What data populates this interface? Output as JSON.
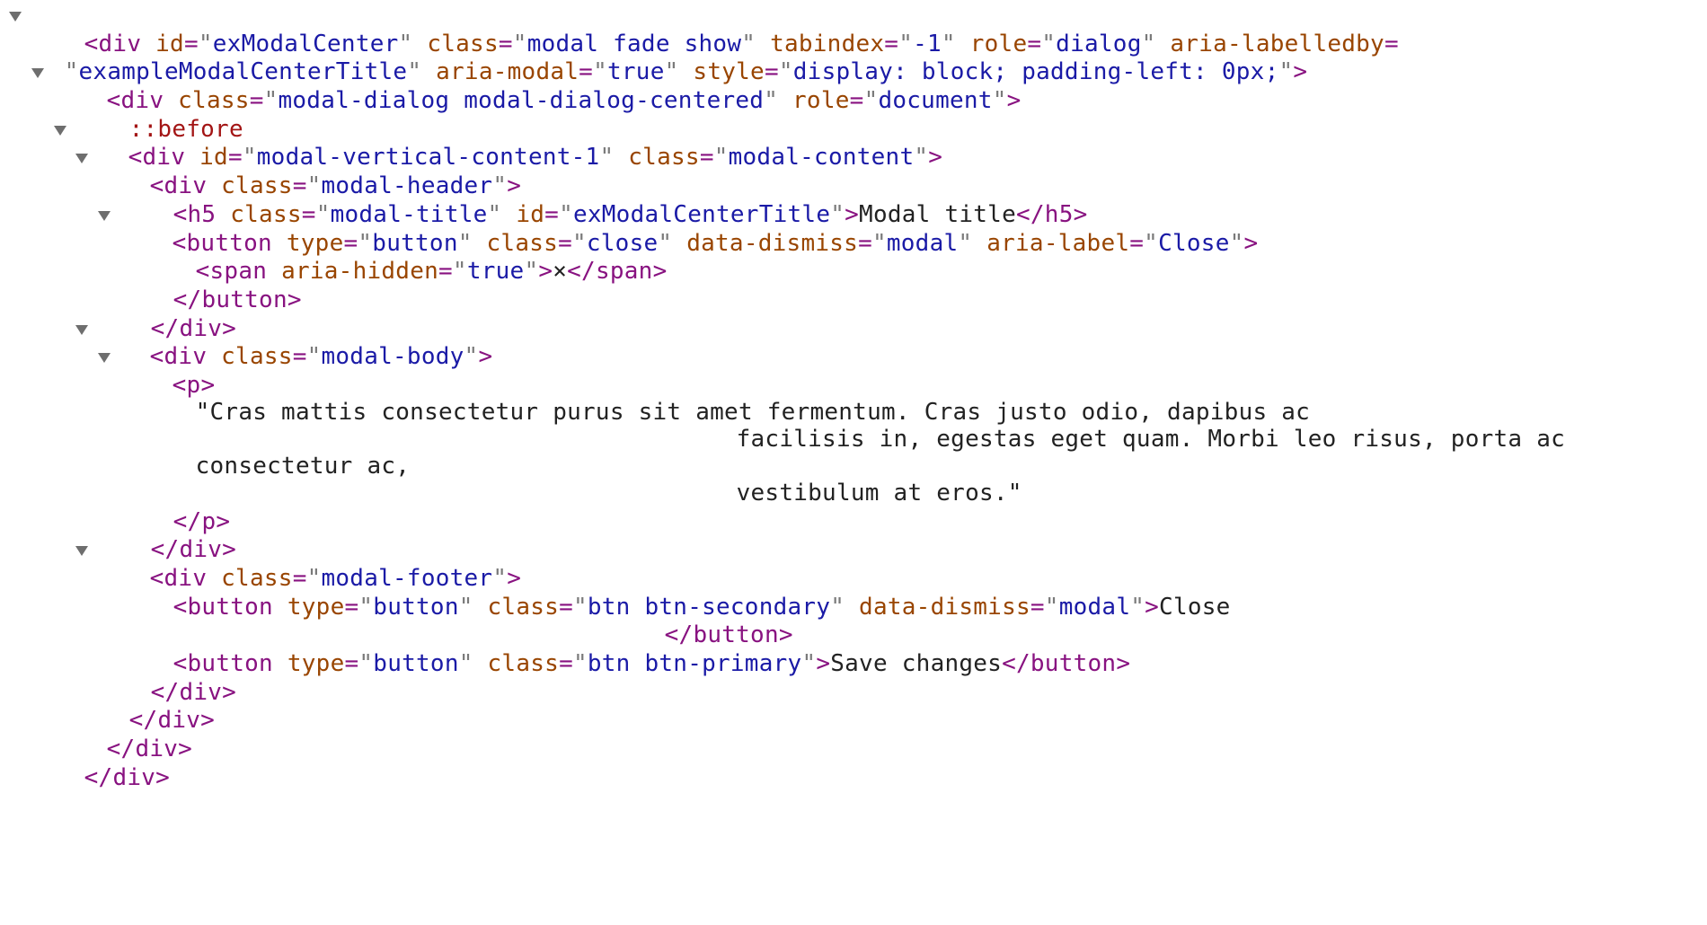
{
  "dom": {
    "l1": {
      "tag": "div",
      "a1": "id",
      "v1": "exModalCenter",
      "a2": "class",
      "v2": "modal fade show",
      "a3": "tabindex",
      "v3": "-1",
      "a4": "role",
      "v4": "dialog",
      "a5": "aria-labelledby",
      "v5": "exampleModalCenterTitle",
      "a6": "aria-modal",
      "v6": "true",
      "a7": "style",
      "v7": "display: block; padding-left: 0px;"
    },
    "l2": {
      "tag": "div",
      "a1": "class",
      "v1": "modal-dialog modal-dialog-centered",
      "a2": "role",
      "v2": "document"
    },
    "l3": {
      "pseudo": "::before"
    },
    "l4": {
      "tag": "div",
      "a1": "id",
      "v1": "modal-vertical-content-1",
      "a2": "class",
      "v2": "modal-content"
    },
    "l5": {
      "tag": "div",
      "a1": "class",
      "v1": "modal-header"
    },
    "l6": {
      "tag": "h5",
      "a1": "class",
      "v1": "modal-title",
      "a2": "id",
      "v2": "exModalCenterTitle",
      "text": "Modal title",
      "close": "h5"
    },
    "l7": {
      "tag": "button",
      "a1": "type",
      "v1": "button",
      "a2": "class",
      "v2": "close",
      "a3": "data-dismiss",
      "v3": "modal",
      "a4": "aria-label",
      "v4": "Close"
    },
    "l8": {
      "tag": "span",
      "a1": "aria-hidden",
      "v1": "true",
      "text": "×",
      "close": "span"
    },
    "l9": {
      "close": "button"
    },
    "l10": {
      "close": "div"
    },
    "l11": {
      "tag": "div",
      "a1": "class",
      "v1": "modal-body"
    },
    "l12": {
      "tag": "p"
    },
    "p_lines": [
      "\"Cras mattis consectetur purus sit amet fermentum. Cras justo odio, dapibus ac",
      "facilisis in, egestas eget quam. Morbi leo risus, porta ac",
      "consectetur ac,",
      "vestibulum at eros.\""
    ],
    "l13": {
      "close": "p"
    },
    "l14": {
      "close": "div"
    },
    "l15": {
      "tag": "div",
      "a1": "class",
      "v1": "modal-footer"
    },
    "l16": {
      "tag": "button",
      "a1": "type",
      "v1": "button",
      "a2": "class",
      "v2": "btn btn-secondary",
      "a3": "data-dismiss",
      "v3": "modal",
      "text": "Close",
      "close": "button"
    },
    "l17": {
      "tag": "button",
      "a1": "type",
      "v1": "button",
      "a2": "class",
      "v2": "btn btn-primary",
      "text": "Save changes",
      "close": "button"
    },
    "l18": {
      "close": "div"
    },
    "l19": {
      "close": "div"
    },
    "l20": {
      "close": "div"
    },
    "l21": {
      "close": "div"
    }
  }
}
